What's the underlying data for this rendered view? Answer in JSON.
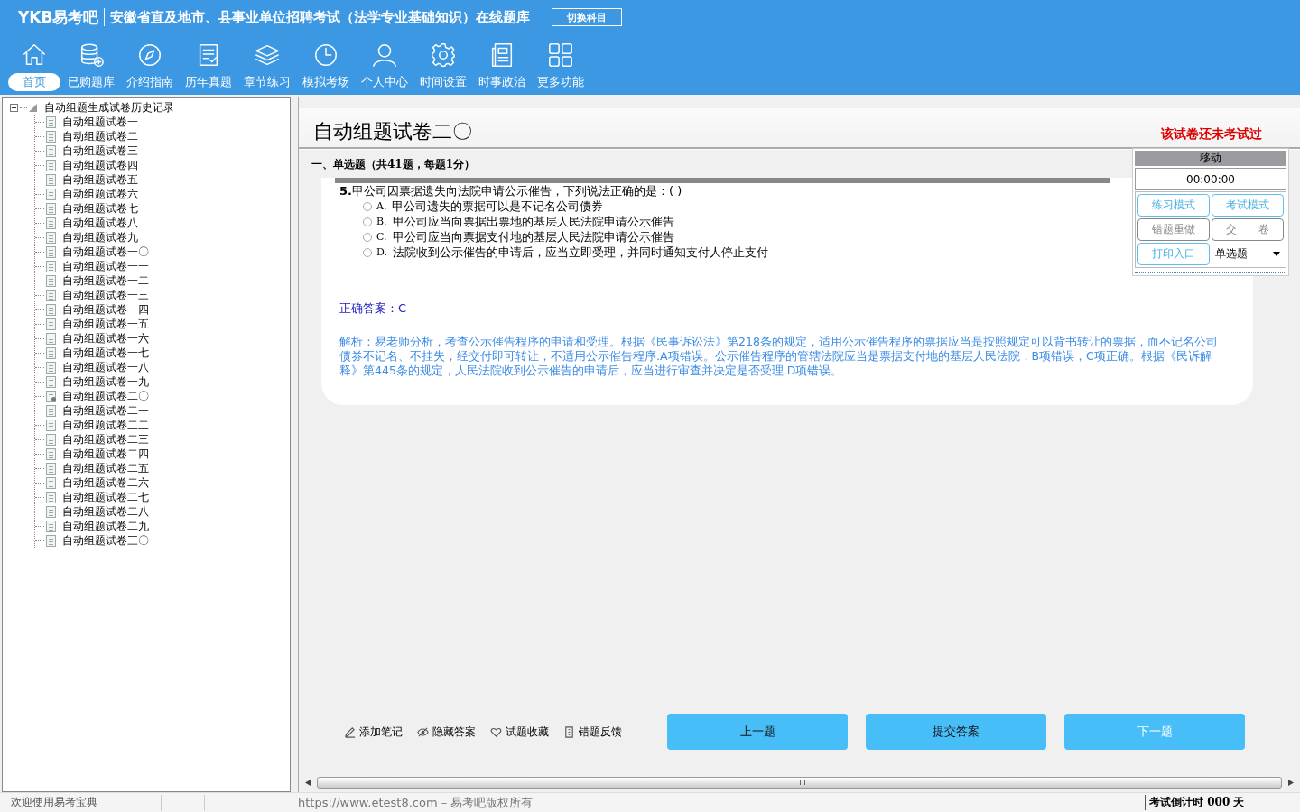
{
  "header": {
    "logo": "YKB易考吧",
    "title": "安徽省直及地市、县事业单位招聘考试（法学专业基础知识）在线题库",
    "switch_button": "切换科目"
  },
  "nav": [
    {
      "label": "首页",
      "selected": true
    },
    {
      "label": "已购题库",
      "selected": false
    },
    {
      "label": "介绍指南",
      "selected": false
    },
    {
      "label": "历年真题",
      "selected": false
    },
    {
      "label": "章节练习",
      "selected": false
    },
    {
      "label": "模拟考场",
      "selected": false
    },
    {
      "label": "个人中心",
      "selected": false
    },
    {
      "label": "时间设置",
      "selected": false
    },
    {
      "label": "时事政治",
      "selected": false
    },
    {
      "label": "更多功能",
      "selected": false
    }
  ],
  "tree": {
    "label": "自动组题生成试卷历史记录",
    "expanded": true,
    "children": [
      {
        "label": "自动组题试卷一",
        "kind": "doc"
      },
      {
        "label": "自动组题试卷二",
        "kind": "doc"
      },
      {
        "label": "自动组题试卷三",
        "kind": "doc"
      },
      {
        "label": "自动组题试卷四",
        "kind": "doc"
      },
      {
        "label": "自动组题试卷五",
        "kind": "doc"
      },
      {
        "label": "自动组题试卷六",
        "kind": "doc"
      },
      {
        "label": "自动组题试卷七",
        "kind": "doc"
      },
      {
        "label": "自动组题试卷八",
        "kind": "doc"
      },
      {
        "label": "自动组题试卷九",
        "kind": "doc"
      },
      {
        "label": "自动组题试卷一〇",
        "kind": "doc"
      },
      {
        "label": "自动组题试卷一一",
        "kind": "doc"
      },
      {
        "label": "自动组题试卷一二",
        "kind": "doc"
      },
      {
        "label": "自动组题试卷一三",
        "kind": "doc"
      },
      {
        "label": "自动组题试卷一四",
        "kind": "doc"
      },
      {
        "label": "自动组题试卷一五",
        "kind": "doc"
      },
      {
        "label": "自动组题试卷一六",
        "kind": "doc"
      },
      {
        "label": "自动组题试卷一七",
        "kind": "doc"
      },
      {
        "label": "自动组题试卷一八",
        "kind": "doc"
      },
      {
        "label": "自动组题试卷一九",
        "kind": "doc"
      },
      {
        "label": "自动组题试卷二〇",
        "kind": "current"
      },
      {
        "label": "自动组题试卷二一",
        "kind": "doc"
      },
      {
        "label": "自动组题试卷二二",
        "kind": "doc"
      },
      {
        "label": "自动组题试卷二三",
        "kind": "doc"
      },
      {
        "label": "自动组题试卷二四",
        "kind": "doc"
      },
      {
        "label": "自动组题试卷二五",
        "kind": "doc"
      },
      {
        "label": "自动组题试卷二六",
        "kind": "doc"
      },
      {
        "label": "自动组题试卷二七",
        "kind": "doc"
      },
      {
        "label": "自动组题试卷二八",
        "kind": "doc"
      },
      {
        "label": "自动组题试卷二九",
        "kind": "doc"
      },
      {
        "label": "自动组题试卷三〇",
        "kind": "doc"
      }
    ]
  },
  "paper": {
    "title": "自动组题试卷二〇",
    "status": "该试卷还未考试过",
    "section": "一、单选题（共41题，每题1分）"
  },
  "question": {
    "number": "5.",
    "text": "甲公司因票据遗失向法院申请公示催告，下列说法正确的是：( )",
    "options": [
      {
        "letter": "A.",
        "text": "甲公司遗失的票据可以是不记名公司债券",
        "selected": false
      },
      {
        "letter": "B.",
        "text": "甲公司应当向票据出票地的基层人民法院申请公示催告",
        "selected": false
      },
      {
        "letter": "C.",
        "text": "甲公司应当向票据支付地的基层人民法院申请公示催告",
        "selected": false
      },
      {
        "letter": "D.",
        "text": "法院收到公示催告的申请后，应当立即受理，并同时通知支付人停止支付",
        "selected": false
      }
    ],
    "answer": "正确答案：C",
    "analysis": "解析：易老师分析，考查公示催告程序的申请和受理。根据《民事诉讼法》第218条的规定，适用公示催告程序的票据应当是按照规定可以背书转让的票据，而不记名公司债券不记名、不挂失，经交付即可转让，不适用公示催告程序.A项错误。公示催告程序的管辖法院应当是票据支付地的基层人民法院，B项错误，C项正确。根据《民诉解释》第445条的规定，人民法院收到公示催告的申请后，应当进行审查并决定是否受理.D项错误。"
  },
  "side_panel": {
    "title": "移动",
    "timer": "00:00:00",
    "buttons": [
      {
        "label": "练习模式",
        "disabled": false
      },
      {
        "label": "考试模式",
        "disabled": false
      },
      {
        "label": "错题重做",
        "disabled": true
      },
      {
        "label": "交　　卷",
        "disabled": true
      },
      {
        "label": "打印入口",
        "disabled": false
      }
    ],
    "type_select": "单选题"
  },
  "tools": [
    {
      "label": "添加笔记"
    },
    {
      "label": "隐藏答案"
    },
    {
      "label": "试题收藏"
    },
    {
      "label": "错题反馈"
    }
  ],
  "actions": [
    {
      "label": "上一题",
      "disabled": false
    },
    {
      "label": "提交答案",
      "disabled": false
    },
    {
      "label": "下一题",
      "disabled": true
    }
  ],
  "status_bar": {
    "welcome": "欢迎使用易考宝典",
    "copyright": "https://www.etest8.com – 易考吧版权所有",
    "countdown": "考试倒计时 000 天"
  }
}
